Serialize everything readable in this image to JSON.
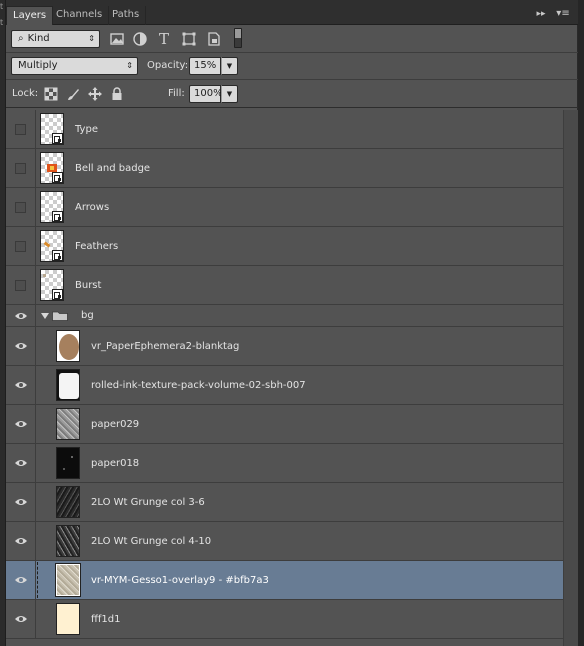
{
  "panel": {
    "tabs": [
      {
        "label": "Layers",
        "active": true
      },
      {
        "label": "Channels",
        "active": false
      },
      {
        "label": "Paths",
        "active": false
      }
    ],
    "collapse_glyph": "▸▸",
    "menu_glyph": "▾≡"
  },
  "filter": {
    "kind_label": "Kind",
    "search_glyph": "⌕",
    "icons": [
      "pixel-filter-icon",
      "adjustment-filter-icon",
      "type-filter-icon",
      "shape-filter-icon",
      "smart-object-filter-icon"
    ],
    "type_glyph": "T"
  },
  "blend": {
    "mode": "Multiply",
    "opacity_label": "Opacity:",
    "opacity_value": "15%"
  },
  "lock": {
    "label": "Lock:",
    "fill_label": "Fill:",
    "fill_value": "100%"
  },
  "colors": {
    "panel_bg": "#535353",
    "selected_row": "#687c94",
    "row_divider": "#3d3d3d"
  },
  "layers": [
    {
      "name": "Type",
      "visible": false,
      "kind": "smart",
      "thumb": "checker"
    },
    {
      "name": "Bell and badge",
      "visible": false,
      "kind": "smart",
      "thumb": "checker-bell"
    },
    {
      "name": "Arrows",
      "visible": false,
      "kind": "smart",
      "thumb": "checker"
    },
    {
      "name": "Feathers",
      "visible": false,
      "kind": "smart",
      "thumb": "checker-feather"
    },
    {
      "name": "Burst",
      "visible": false,
      "kind": "smart",
      "thumb": "checker-burst"
    },
    {
      "name": "bg",
      "visible": true,
      "kind": "group"
    },
    {
      "name": "vr_PaperEphemera2-blanktag",
      "visible": true,
      "kind": "pixel",
      "thumb": "tag"
    },
    {
      "name": "rolled-ink-texture-pack-volume-02-sbh-007",
      "visible": true,
      "kind": "pixel",
      "thumb": "white-ink"
    },
    {
      "name": "paper029",
      "visible": true,
      "kind": "pixel",
      "thumb": "grey-noise"
    },
    {
      "name": "paper018",
      "visible": true,
      "kind": "pixel",
      "thumb": "black"
    },
    {
      "name": "2LO Wt Grunge col 3-6",
      "visible": true,
      "kind": "pixel",
      "thumb": "dark-grunge"
    },
    {
      "name": "2LO Wt Grunge col 4-10",
      "visible": true,
      "kind": "pixel",
      "thumb": "dark-grunge-2"
    },
    {
      "name": "vr-MYM-Gesso1-overlay9 - #bfb7a3",
      "visible": true,
      "kind": "pixel",
      "thumb": "gesso",
      "selected": true
    },
    {
      "name": "fff1d1",
      "visible": true,
      "kind": "pixel",
      "thumb": "cream"
    }
  ]
}
